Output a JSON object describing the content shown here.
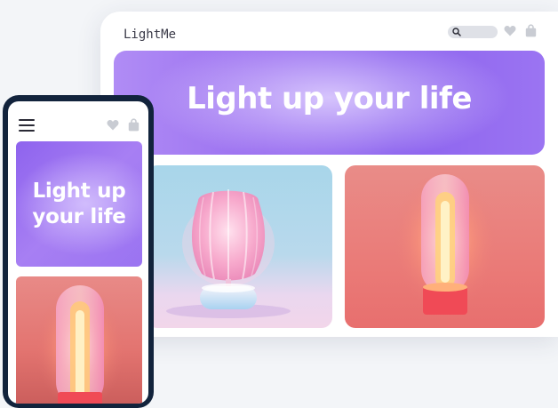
{
  "desktop": {
    "brand": "LightMe",
    "hero_title": "Light up your life",
    "icons": [
      "search-icon",
      "heart-icon",
      "shopping-bag-icon"
    ],
    "products": [
      {
        "image": "pink-ribbed-table-lamp"
      },
      {
        "image": "glowing-capsule-lamp"
      }
    ]
  },
  "mobile": {
    "hero_title_line1": "Light up",
    "hero_title_line2": "your life",
    "icons": [
      "hamburger-menu-icon",
      "heart-icon",
      "shopping-bag-icon"
    ],
    "products": [
      {
        "image": "glowing-capsule-lamp"
      }
    ]
  },
  "colors": {
    "hero_purple": "#9a6ff0",
    "phone_frame": "#12233c",
    "card_red": "#ea7b78",
    "card_blue": "#b9d9ec"
  }
}
